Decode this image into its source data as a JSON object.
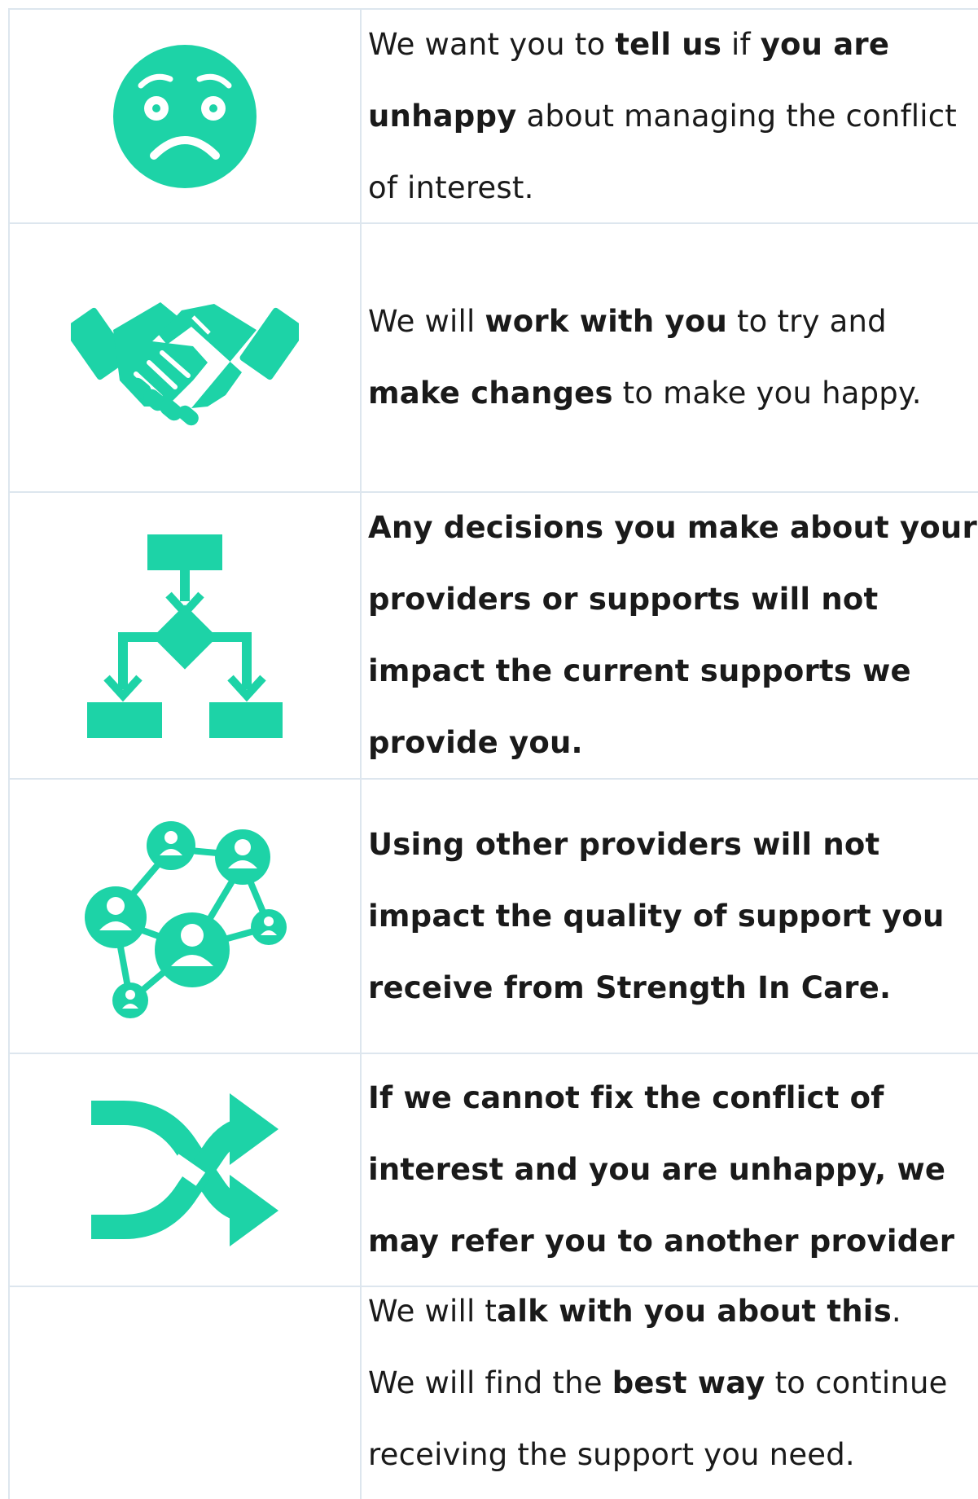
{
  "colors": {
    "accent": "#1dd3a7",
    "border": "#dde6ee",
    "text": "#1a1a1a"
  },
  "rows": [
    {
      "icon": "worried-face-icon",
      "lines": [
        [
          "We want you to ",
          "tell us",
          " if ",
          "you are"
        ],
        [
          "unhappy",
          " about managing the conflict"
        ],
        [
          "of interest."
        ]
      ]
    },
    {
      "icon": "handshake-icon",
      "lines": [
        [
          "We will ",
          "work with you",
          " to try and"
        ],
        [
          "make changes",
          " to make you happy."
        ]
      ]
    },
    {
      "icon": "flowchart-icon",
      "lines": [
        "Any decisions you make about your",
        "providers or supports will not",
        "impact the current supports we",
        "provide you."
      ]
    },
    {
      "icon": "people-network-icon",
      "lines": [
        "Using other providers will not",
        "impact the quality of support you",
        "receive from Strength In Care."
      ]
    },
    {
      "icon": "shuffle-arrows-icon",
      "lines": [
        "If we cannot fix the conflict of",
        "interest and you are unhappy, we",
        "may refer you to another provider"
      ]
    },
    {
      "icon": "",
      "lines": [
        [
          "We will t",
          "alk with you about this",
          "."
        ],
        [
          "We will find the ",
          "best way",
          " to continue"
        ],
        [
          "receiving the support you need."
        ]
      ]
    }
  ]
}
